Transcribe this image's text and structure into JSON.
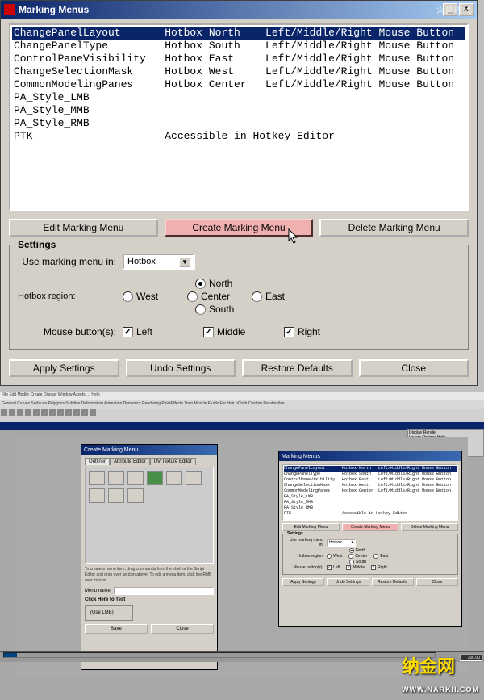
{
  "window": {
    "title": "Marking Menus",
    "minimize": "_",
    "close": "X"
  },
  "list": {
    "rows": [
      {
        "c1": "ChangePanelLayout",
        "c2": "Hotbox North",
        "c3": "Left/Middle/Right Mouse Button",
        "sel": true
      },
      {
        "c1": "ChangePanelType",
        "c2": "Hotbox South",
        "c3": "Left/Middle/Right Mouse Button"
      },
      {
        "c1": "ControlPaneVisibility",
        "c2": "Hotbox East",
        "c3": "Left/Middle/Right Mouse Button"
      },
      {
        "c1": "ChangeSelectionMask",
        "c2": "Hotbox West",
        "c3": "Left/Middle/Right Mouse Button"
      },
      {
        "c1": "CommonModelingPanes",
        "c2": "Hotbox Center",
        "c3": "Left/Middle/Right Mouse Button"
      },
      {
        "c1": "PA_Style_LMB",
        "c2": "",
        "c3": ""
      },
      {
        "c1": "PA_Style_MMB",
        "c2": "",
        "c3": ""
      },
      {
        "c1": "PA_Style_RMB",
        "c2": "",
        "c3": ""
      },
      {
        "c1": "PTK",
        "c2": "Accessible in Hotkey Editor",
        "c3": ""
      }
    ]
  },
  "buttons": {
    "edit": "Edit Marking Menu",
    "create": "Create Marking Menu",
    "delete": "Delete Marking Menu"
  },
  "settings": {
    "title": "Settings",
    "use_label": "Use marking menu in:",
    "use_value": "Hotbox",
    "region_label": "Hotbox region:",
    "regions": {
      "north": "North",
      "west": "West",
      "center": "Center",
      "east": "East",
      "south": "South"
    },
    "region_selected": "north",
    "mouse_label": "Mouse button(s):",
    "mouse": {
      "left": "Left",
      "middle": "Middle",
      "right": "Right"
    }
  },
  "bottom": {
    "apply": "Apply Settings",
    "undo": "Undo Settings",
    "restore": "Restore Defaults",
    "close": "Close"
  },
  "lower": {
    "left_dialog": {
      "title": "Create Marking Menu",
      "tabs": [
        "Outliner",
        "Attribute Editor",
        "UV Texture Editor"
      ],
      "hint": "To create a menu item, drag commands from the shelf or the Script Editor and drop over an icon above. To edit a menu item, click the RMB over its icon.",
      "menu_name_label": "Menu name:",
      "click_test": "Click Here to Test",
      "use_lmb": "(Use LMB)",
      "save": "Save",
      "close": "Close"
    },
    "right_dialog": {
      "title": "Marking Menus",
      "edit": "Edit Marking Menu",
      "create": "Create Marking Menu",
      "delete": "Delete Marking Menu",
      "settings_title": "Settings",
      "use_label": "Use marking menu in:",
      "use_value": "Hotbox",
      "region_label": "Hotbox region:",
      "north": "North",
      "west": "West",
      "center": "Center",
      "east": "East",
      "south": "South",
      "mouse_label": "Mouse button(s):",
      "left": "Left",
      "middle": "Middle",
      "right": "Right",
      "apply": "Apply Settings",
      "undo": "Undo Settings",
      "restore": "Restore Defaults",
      "close": "Close"
    },
    "timeline_end": "200.00"
  },
  "watermark": "火星时代",
  "logo": {
    "cn": "纳金网",
    "url": "WWW.NARKII.COM"
  }
}
